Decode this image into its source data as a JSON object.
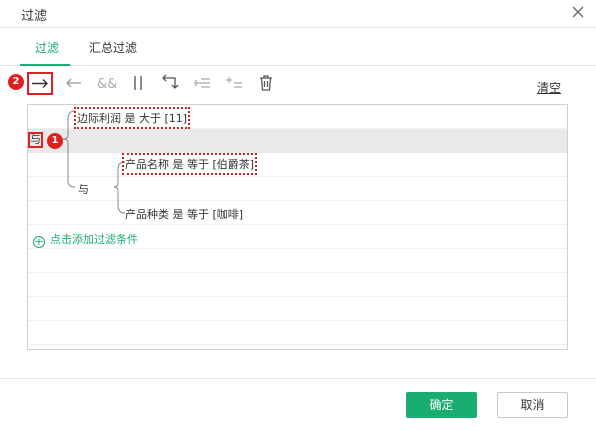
{
  "dialog": {
    "title": "过滤"
  },
  "tabs": [
    {
      "label": "过滤",
      "active": true
    },
    {
      "label": "汇总过滤",
      "active": false
    }
  ],
  "toolbar": {
    "callout": "2",
    "clear_label": "清空",
    "tools": [
      "indent-right-icon",
      "indent-left-icon",
      "and-icon",
      "or-icon",
      "swap-icon",
      "add-condition-icon",
      "add-group-icon",
      "delete-icon"
    ]
  },
  "filter_tree": {
    "root_operator": "与",
    "root_callout": "1",
    "sub_operator": "与",
    "conditions": [
      {
        "text": "边际利润 是 大于 [11]"
      },
      {
        "text": "产品名称 是 等于 [伯爵茶]"
      },
      {
        "text": "产品种类 是 等于 [咖啡]"
      }
    ],
    "add_label": "点击添加过滤条件"
  },
  "footer": {
    "ok_label": "确定",
    "cancel_label": "取消"
  },
  "colors": {
    "accent": "#1aad71",
    "callout": "#e0201e"
  }
}
